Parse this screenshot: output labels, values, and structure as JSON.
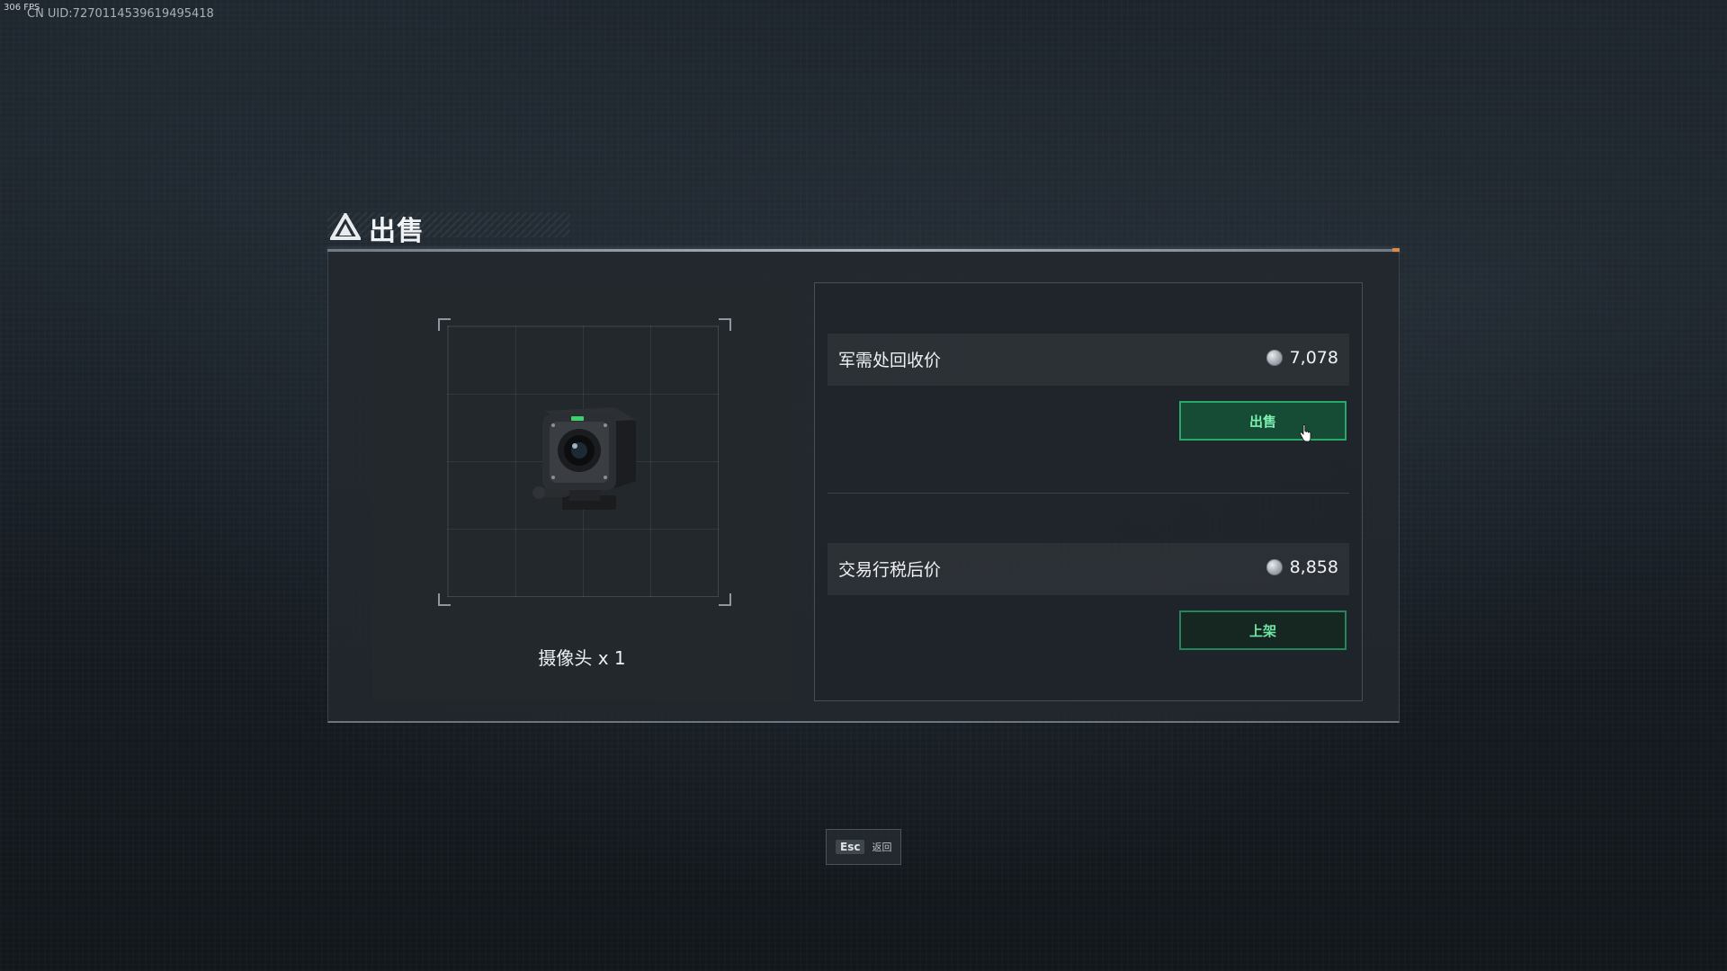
{
  "overlay": {
    "fps": "306 FPS",
    "uid": "CN UID:727011453961949541​8"
  },
  "dialog": {
    "title": "出售",
    "title_icon": "triangle-logo-icon"
  },
  "item": {
    "name": "摄像头 x 1",
    "image_icon": "camera-icon"
  },
  "prices": {
    "recycle": {
      "label": "军需处回收价",
      "value": "7,078",
      "currency_icon": "coin-icon",
      "button_label": "出售"
    },
    "market": {
      "label": "交易行税后价",
      "value": "8,858",
      "currency_icon": "coin-icon",
      "button_label": "上架"
    }
  },
  "footer": {
    "esc_key": "Esc",
    "esc_label": "返回"
  },
  "colors": {
    "button_green_border": "#2aa86a",
    "button_green_text": "#7df0b0",
    "button_green_bg": "#164c35",
    "background": "#1a2027"
  }
}
